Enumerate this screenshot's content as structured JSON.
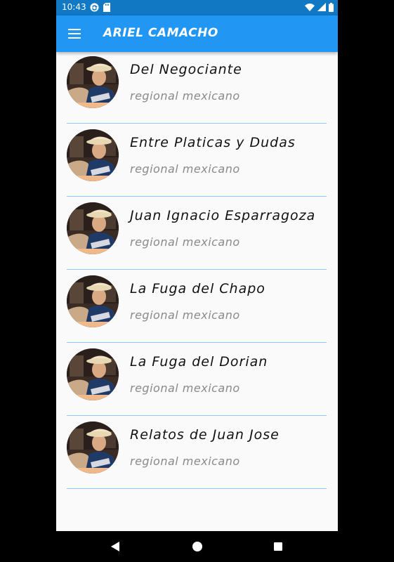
{
  "status_bar": {
    "time": "10:43",
    "left_icons": [
      "sync-icon",
      "sd-card-icon"
    ],
    "right_icons": [
      "wifi-icon",
      "signal-icon",
      "battery-icon"
    ]
  },
  "app_bar": {
    "menu_icon": "hamburger-menu-icon",
    "title": "ARIEL CAMACHO",
    "color": "#2196f3",
    "status_color": "#1178c4"
  },
  "songs": [
    {
      "title": "Del Negociante",
      "genre": "regional mexicano"
    },
    {
      "title": "Entre Platicas y Dudas",
      "genre": "regional mexicano"
    },
    {
      "title": "Juan Ignacio Esparragoza",
      "genre": "regional mexicano"
    },
    {
      "title": "La Fuga del Chapo",
      "genre": "regional mexicano"
    },
    {
      "title": "La Fuga del Dorian",
      "genre": "regional mexicano"
    },
    {
      "title": "Relatos de Juan Jose",
      "genre": "regional mexicano"
    }
  ],
  "divider_color": "#90caf9",
  "nav_bar": {
    "buttons": [
      "back-icon",
      "home-icon",
      "recents-icon"
    ]
  }
}
